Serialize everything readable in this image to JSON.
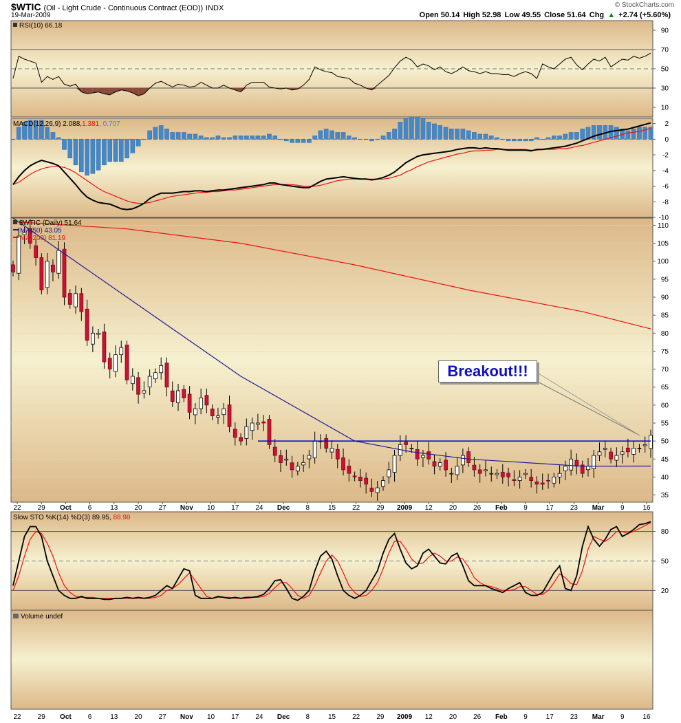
{
  "header": {
    "symbol": "$WTIC",
    "description": "(Oil - Light Crude - Continuous Contract (EOD))",
    "exchange": "INDX",
    "date": "19-Mar-2009",
    "brand": "© StockCharts.com",
    "open": "Open 50.14",
    "high": "High 52.98",
    "low": "Low 49.55",
    "close": "Close 51.64",
    "chg_label": "Chg",
    "chg": "+2.74 (+5.60%)",
    "chg_arrow": "▲"
  },
  "panels": {
    "rsi": {
      "label": "RSI(10) 66.18"
    },
    "macd": {
      "label_a": "MACD(12,26,9) 2.088,",
      "label_b": "1.381",
      "label_c": ", 0.707"
    },
    "price": {
      "label": "$WTIC (Daily) 51.64",
      "ma50": "MA(50) 43.05",
      "ma200": "MA(200) 81.19"
    },
    "sto": {
      "label_a": "Slow STO %K(14) %D(3) 89.95,",
      "label_b": "88.98"
    },
    "volume": {
      "label": "Volume undef"
    }
  },
  "annotation": {
    "text": "Breakout!!!"
  },
  "colors": {
    "up": "#000000",
    "down": "#cc1133",
    "ma50": "#1a1a9a",
    "ma200": "#ee1111",
    "macd_hist": "#4488cc",
    "rsi_fill": "#8b4a3a",
    "breakout_line": "#0000cc",
    "panel_bg": "#deba8a",
    "panel_bg_light": "#f4eccb"
  },
  "chart_data": [
    {
      "type": "candlestick",
      "title": "$WTIC (Daily) 51.64",
      "ylim": [
        33,
        112
      ],
      "y_ticks": [
        35,
        40,
        45,
        50,
        55,
        60,
        65,
        70,
        75,
        80,
        85,
        90,
        95,
        100,
        105,
        110
      ],
      "x_tick_labels": [
        "22",
        "29",
        "Oct",
        "6",
        "13",
        "20",
        "27",
        "Nov",
        "10",
        "17",
        "24",
        "Dec",
        "8",
        "15",
        "22",
        "29",
        "2009",
        "12",
        "20",
        "26",
        "Feb",
        "9",
        "17",
        "23",
        "Mar",
        "9",
        "16"
      ],
      "close_series": [
        97,
        107,
        108,
        105,
        101,
        92,
        100,
        97,
        103,
        90,
        88,
        91,
        86,
        78,
        80,
        80,
        72,
        70,
        74,
        76,
        67,
        68,
        63,
        64,
        68,
        69,
        71,
        65,
        61,
        64,
        62,
        58,
        59,
        62,
        60,
        57,
        57,
        59,
        54,
        51,
        50,
        54,
        55,
        55,
        55,
        49,
        46,
        44,
        45,
        42,
        43,
        44,
        46,
        50,
        50,
        48,
        48,
        45,
        42,
        41,
        40,
        39,
        38,
        36,
        37,
        39,
        42,
        46,
        49,
        49,
        48,
        45,
        46,
        45,
        43,
        44,
        42,
        41,
        43,
        46,
        44,
        42,
        41,
        42,
        41,
        41,
        40,
        40,
        39,
        40,
        41,
        39,
        38,
        38,
        39,
        40,
        41,
        43,
        45,
        43,
        41,
        43,
        46,
        47,
        48,
        45,
        46,
        47,
        47,
        48,
        48,
        49,
        51.64
      ],
      "series": [
        {
          "name": "MA(50)",
          "x": [
            0,
            20,
            40,
            60,
            70,
            80,
            100,
            112
          ],
          "values": [
            112,
            90,
            68,
            50,
            47,
            45,
            43,
            43.05
          ]
        },
        {
          "name": "MA(200)",
          "x": [
            0,
            20,
            40,
            60,
            80,
            100,
            112
          ],
          "values": [
            111,
            109,
            105,
            99,
            92,
            86,
            81.19
          ]
        }
      ],
      "annotations": [
        {
          "text": "Breakout!!!",
          "level": 50
        }
      ]
    },
    {
      "type": "line",
      "title": "RSI(10) 66.18",
      "ylim": [
        0,
        100
      ],
      "y_ticks": [
        10,
        30,
        50,
        70,
        90
      ],
      "values": [
        40,
        63,
        60,
        58,
        56,
        36,
        42,
        39,
        42,
        34,
        32,
        34,
        26,
        24,
        25,
        26,
        24,
        23,
        26,
        28,
        27,
        25,
        22,
        24,
        30,
        35,
        37,
        34,
        31,
        34,
        33,
        31,
        32,
        36,
        33,
        30,
        30,
        33,
        30,
        28,
        26,
        33,
        36,
        36,
        36,
        31,
        30,
        29,
        30,
        28,
        29,
        33,
        39,
        52,
        49,
        47,
        46,
        42,
        41,
        40,
        35,
        33,
        30,
        28,
        33,
        38,
        43,
        51,
        58,
        62,
        59,
        52,
        55,
        53,
        49,
        52,
        47,
        45,
        48,
        52,
        48,
        47,
        45,
        47,
        45,
        45,
        44,
        44,
        42,
        45,
        47,
        45,
        40,
        55,
        52,
        50,
        55,
        60,
        62,
        54,
        49,
        55,
        60,
        58,
        62,
        52,
        56,
        60,
        59,
        63,
        61,
        63,
        66.18
      ]
    },
    {
      "type": "line",
      "title": "MACD(12,26,9)",
      "ylim": [
        -10,
        2.5
      ],
      "y_ticks": [
        2,
        0,
        -2,
        -4,
        -6,
        -8,
        -10
      ],
      "series": [
        {
          "name": "MACD",
          "values": [
            -5.8,
            -4.8,
            -4.0,
            -3.4,
            -3.0,
            -2.7,
            -2.9,
            -3.1,
            -3.4,
            -4.2,
            -5.0,
            -5.8,
            -6.7,
            -7.4,
            -7.8,
            -8.1,
            -8.2,
            -8.3,
            -8.6,
            -8.9,
            -9.0,
            -8.9,
            -8.6,
            -8.2,
            -7.6,
            -7.2,
            -6.9,
            -6.9,
            -6.9,
            -6.8,
            -6.7,
            -6.7,
            -6.6,
            -6.6,
            -6.7,
            -6.6,
            -6.5,
            -6.5,
            -6.4,
            -6.3,
            -6.2,
            -6.1,
            -6.0,
            -5.9,
            -5.8,
            -5.6,
            -5.6,
            -5.8,
            -5.9,
            -6.0,
            -6.1,
            -6.2,
            -6.2,
            -5.8,
            -5.4,
            -5.1,
            -5.0,
            -4.9,
            -4.8,
            -4.9,
            -5.0,
            -5.1,
            -5.1,
            -5.2,
            -5.1,
            -4.9,
            -4.6,
            -4.2,
            -3.6,
            -3.0,
            -2.6,
            -2.2,
            -2.0,
            -1.9,
            -1.8,
            -1.7,
            -1.6,
            -1.5,
            -1.3,
            -1.2,
            -1.1,
            -1.1,
            -1.2,
            -1.1,
            -1.2,
            -1.2,
            -1.3,
            -1.4,
            -1.4,
            -1.4,
            -1.4,
            -1.5,
            -1.3,
            -1.3,
            -1.2,
            -1.1,
            -1.0,
            -0.9,
            -0.7,
            -0.5,
            -0.2,
            0.1,
            0.4,
            0.6,
            0.8,
            1.0,
            1.1,
            1.2,
            1.3,
            1.5,
            1.7,
            1.9,
            2.088
          ]
        },
        {
          "name": "Signal",
          "values": [
            -5.8,
            -5.5,
            -5.0,
            -4.5,
            -4.1,
            -3.8,
            -3.6,
            -3.5,
            -3.5,
            -3.6,
            -3.9,
            -4.3,
            -4.8,
            -5.3,
            -5.8,
            -6.3,
            -6.7,
            -7.0,
            -7.3,
            -7.6,
            -7.9,
            -8.1,
            -8.2,
            -8.2,
            -8.1,
            -7.9,
            -7.7,
            -7.5,
            -7.3,
            -7.2,
            -7.1,
            -7.0,
            -6.9,
            -6.8,
            -6.8,
            -6.7,
            -6.7,
            -6.6,
            -6.5,
            -6.5,
            -6.4,
            -6.3,
            -6.2,
            -6.1,
            -6.0,
            -5.9,
            -5.8,
            -5.8,
            -5.8,
            -5.8,
            -5.9,
            -6.0,
            -6.0,
            -6.0,
            -5.9,
            -5.7,
            -5.5,
            -5.3,
            -5.2,
            -5.1,
            -5.1,
            -5.1,
            -5.1,
            -5.1,
            -5.1,
            -5.1,
            -5.0,
            -4.8,
            -4.6,
            -4.2,
            -3.9,
            -3.5,
            -3.2,
            -2.9,
            -2.7,
            -2.5,
            -2.3,
            -2.1,
            -1.9,
            -1.8,
            -1.6,
            -1.5,
            -1.5,
            -1.4,
            -1.4,
            -1.3,
            -1.3,
            -1.3,
            -1.3,
            -1.3,
            -1.3,
            -1.4,
            -1.4,
            -1.3,
            -1.3,
            -1.3,
            -1.2,
            -1.2,
            -1.1,
            -0.9,
            -0.8,
            -0.6,
            -0.4,
            -0.2,
            0.0,
            0.2,
            0.4,
            0.6,
            0.8,
            0.9,
            1.0,
            1.2,
            1.381
          ]
        }
      ]
    },
    {
      "type": "line",
      "title": "Slow STO %K(14) %D(3)",
      "ylim": [
        0,
        100
      ],
      "y_ticks": [
        20,
        50,
        80
      ],
      "series": [
        {
          "name": "%K",
          "values": [
            25,
            50,
            75,
            85,
            85,
            75,
            50,
            35,
            20,
            15,
            12,
            12,
            14,
            12,
            12,
            12,
            11,
            11,
            12,
            12,
            13,
            12,
            13,
            12,
            13,
            15,
            20,
            25,
            22,
            32,
            42,
            40,
            15,
            12,
            12,
            12,
            14,
            13,
            12,
            13,
            12,
            13,
            13,
            14,
            16,
            22,
            30,
            31,
            22,
            12,
            10,
            14,
            20,
            40,
            55,
            60,
            52,
            35,
            20,
            15,
            12,
            15,
            20,
            30,
            40,
            58,
            72,
            78,
            62,
            48,
            42,
            45,
            58,
            62,
            55,
            48,
            47,
            55,
            58,
            45,
            30,
            25,
            25,
            25,
            22,
            20,
            18,
            22,
            25,
            28,
            18,
            15,
            15,
            18,
            28,
            38,
            45,
            22,
            20,
            35,
            65,
            85,
            72,
            65,
            72,
            82,
            85,
            75,
            78,
            82,
            87,
            88,
            89.95
          ]
        },
        {
          "name": "%D",
          "values": [
            20,
            35,
            55,
            72,
            80,
            78,
            68,
            55,
            38,
            25,
            18,
            14,
            13,
            13,
            13,
            12,
            12,
            12,
            12,
            12,
            12,
            12,
            12,
            12,
            12,
            13,
            15,
            20,
            22,
            26,
            32,
            38,
            30,
            22,
            14,
            12,
            13,
            13,
            13,
            12,
            12,
            12,
            13,
            13,
            14,
            17,
            23,
            28,
            28,
            22,
            15,
            12,
            15,
            25,
            38,
            50,
            56,
            50,
            38,
            25,
            18,
            14,
            15,
            20,
            28,
            42,
            58,
            70,
            70,
            62,
            52,
            47,
            48,
            54,
            58,
            55,
            50,
            50,
            54,
            52,
            44,
            33,
            28,
            25,
            24,
            22,
            20,
            20,
            21,
            24,
            24,
            20,
            16,
            16,
            20,
            28,
            37,
            33,
            27,
            26,
            40,
            62,
            75,
            72,
            70,
            74,
            80,
            80,
            78,
            80,
            83,
            86,
            88.98
          ]
        }
      ]
    }
  ]
}
